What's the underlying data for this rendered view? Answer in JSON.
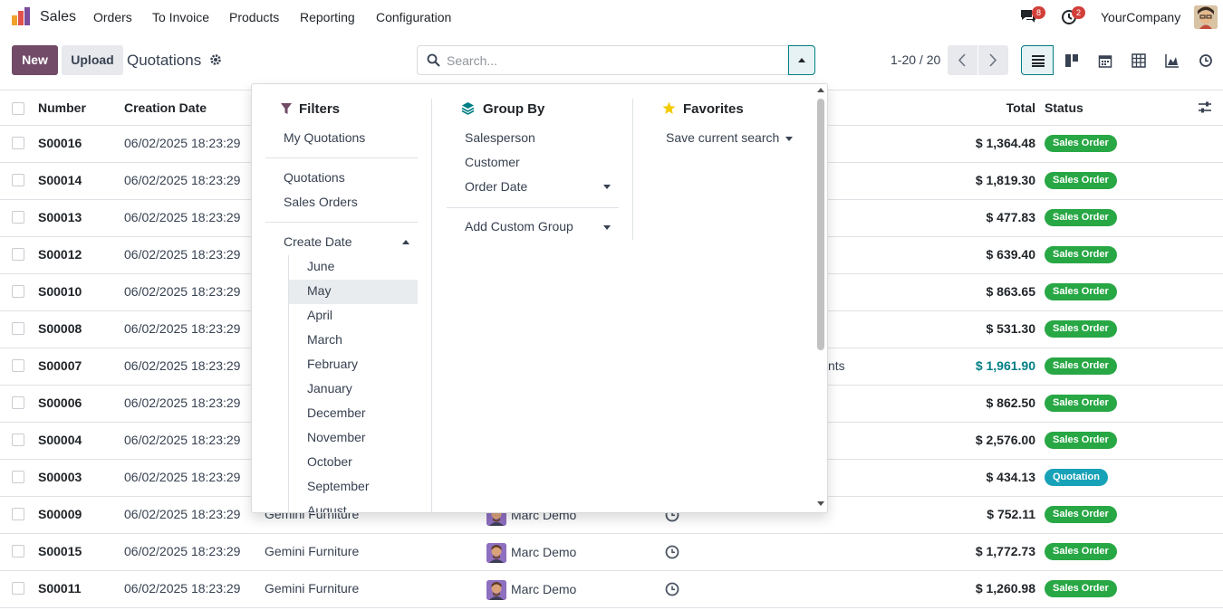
{
  "nav": {
    "app_name": "Sales",
    "menu": [
      "Orders",
      "To Invoice",
      "Products",
      "Reporting",
      "Configuration"
    ],
    "messages_badge": "8",
    "activities_badge": "2",
    "company": "YourCompany"
  },
  "control": {
    "new_label": "New",
    "upload_label": "Upload",
    "breadcrumb": "Quotations",
    "search_placeholder": "Search...",
    "pager": "1-20 / 20"
  },
  "list": {
    "headers": {
      "number": "Number",
      "creation_date": "Creation Date",
      "total": "Total",
      "status": "Status"
    },
    "rows": [
      {
        "number": "S00016",
        "date": "06/02/2025 18:23:29",
        "customer": "",
        "salesperson": "",
        "total": "$ 1,364.48",
        "status": "Sales Order"
      },
      {
        "number": "S00014",
        "date": "06/02/2025 18:23:29",
        "customer": "",
        "salesperson": "",
        "total": "$ 1,819.30",
        "status": "Sales Order"
      },
      {
        "number": "S00013",
        "date": "06/02/2025 18:23:29",
        "customer": "",
        "salesperson": "",
        "total": "$ 477.83",
        "status": "Sales Order"
      },
      {
        "number": "S00012",
        "date": "06/02/2025 18:23:29",
        "customer": "",
        "salesperson": "",
        "total": "$ 639.40",
        "status": "Sales Order"
      },
      {
        "number": "S00010",
        "date": "06/02/2025 18:23:29",
        "customer": "",
        "salesperson": "",
        "total": "$ 863.65",
        "status": "Sales Order"
      },
      {
        "number": "S00008",
        "date": "06/02/2025 18:23:29",
        "customer": "",
        "salesperson": "",
        "total": "$ 531.30",
        "status": "Sales Order"
      },
      {
        "number": "S00007",
        "date": "06/02/2025 18:23:29",
        "customer": "",
        "salesperson": "",
        "total": "$ 1,961.90",
        "status": "Sales Order",
        "extra": "nts"
      },
      {
        "number": "S00006",
        "date": "06/02/2025 18:23:29",
        "customer": "",
        "salesperson": "",
        "total": "$ 862.50",
        "status": "Sales Order"
      },
      {
        "number": "S00004",
        "date": "06/02/2025 18:23:29",
        "customer": "",
        "salesperson": "",
        "total": "$ 2,576.00",
        "status": "Sales Order"
      },
      {
        "number": "S00003",
        "date": "06/02/2025 18:23:29",
        "customer": "",
        "salesperson": "",
        "total": "$ 434.13",
        "status": "Quotation"
      },
      {
        "number": "S00009",
        "date": "06/02/2025 18:23:29",
        "customer": "Gemini Furniture",
        "salesperson": "Marc Demo",
        "total": "$ 752.11",
        "status": "Sales Order"
      },
      {
        "number": "S00015",
        "date": "06/02/2025 18:23:29",
        "customer": "Gemini Furniture",
        "salesperson": "Marc Demo",
        "total": "$ 1,772.73",
        "status": "Sales Order"
      },
      {
        "number": "S00011",
        "date": "06/02/2025 18:23:29",
        "customer": "Gemini Furniture",
        "salesperson": "Marc Demo",
        "total": "$ 1,260.98",
        "status": "Sales Order"
      }
    ]
  },
  "dropdown": {
    "filters_title": "Filters",
    "filters": [
      "My Quotations",
      "Quotations",
      "Sales Orders",
      "Create Date"
    ],
    "months": [
      "June",
      "May",
      "April",
      "March",
      "February",
      "January",
      "December",
      "November",
      "October",
      "September",
      "August"
    ],
    "group_by_title": "Group By",
    "group_by": [
      "Salesperson",
      "Customer",
      "Order Date",
      "Add Custom Group"
    ],
    "favorites_title": "Favorites",
    "favorites": [
      "Save current search"
    ]
  },
  "colors": {
    "brand": "#714b67",
    "accent": "#017e84",
    "status_green": "#28a745",
    "status_teal": "#17a2b8"
  }
}
